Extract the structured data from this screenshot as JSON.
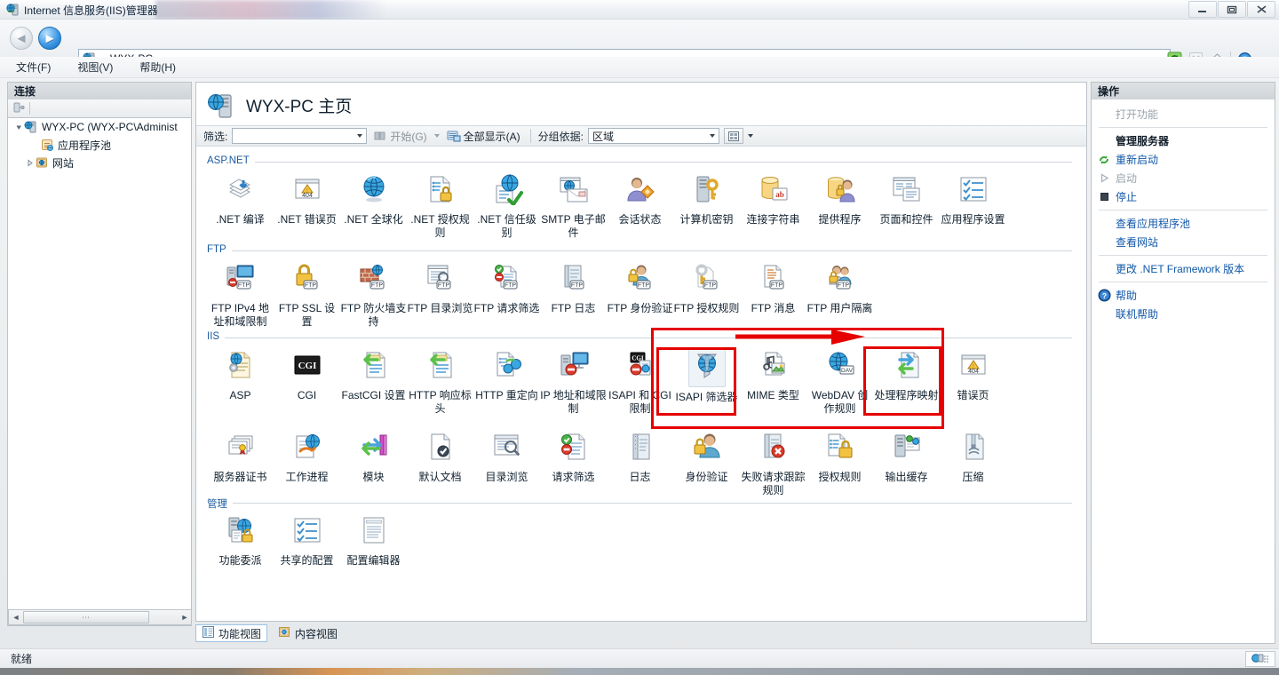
{
  "window": {
    "title": "Internet 信息服务(IIS)管理器",
    "title_icon": "iis-server-icon",
    "minimize_label": "最小化",
    "maximize_label": "最大化",
    "close_label": "关闭"
  },
  "navbar": {
    "back_label": "后退",
    "forward_label": "前进",
    "breadcrumb_icon": "server-icon",
    "breadcrumb": "WYX-PC",
    "sep": "▸",
    "tools": [
      {
        "name": "refresh-icon",
        "glyph": "↻",
        "color": "#2f9a2f"
      },
      {
        "name": "stop-icon",
        "glyph": "✕",
        "color": "#a8b2bb"
      },
      {
        "name": "home-icon",
        "glyph": "⌂",
        "color": "#8c949c"
      },
      {
        "name": "help-icon",
        "glyph": "?",
        "color": "#1d63b5"
      }
    ]
  },
  "menu": {
    "items": [
      {
        "label": "文件(F)",
        "name": "menu-file"
      },
      {
        "label": "视图(V)",
        "name": "menu-view"
      },
      {
        "label": "帮助(H)",
        "name": "menu-help"
      }
    ]
  },
  "connections": {
    "header": "连接",
    "toolbar_icon": "connect-icon",
    "tree": [
      {
        "label": "WYX-PC (WYX-PC\\Administ",
        "indent": 0,
        "twisty": "expanded",
        "icon": "server-icon"
      },
      {
        "label": "应用程序池",
        "indent": 1,
        "twisty": "none",
        "icon": "app-pool-icon"
      },
      {
        "label": "网站",
        "indent": 1,
        "twisty": "collapsed",
        "icon": "sites-icon"
      }
    ],
    "hscroll": {
      "left_arrow": "◄",
      "right_arrow": "►",
      "thumb": "⋯"
    }
  },
  "page": {
    "icon": "server-home-icon",
    "title": "WYX-PC 主页"
  },
  "filterbar": {
    "filter_label": "筛选:",
    "filter_value": "",
    "filter_placeholder": "",
    "go_label": "开始(G)",
    "showall_label": "全部显示(A)",
    "groupby_label": "分组依据:",
    "groupby_value": "区域",
    "view_button": "grid-view-icon"
  },
  "groups": [
    {
      "name": "ASP.NET",
      "title": "ASP.NET",
      "items": [
        {
          "label": ".NET 编译",
          "icon": "net-compilation-icon"
        },
        {
          "label": ".NET 错误页",
          "icon": "net-error-pages-icon"
        },
        {
          "label": ".NET 全球化",
          "icon": "net-globalization-icon"
        },
        {
          "label": ".NET 授权规则",
          "icon": "net-authorization-rules-icon"
        },
        {
          "label": ".NET 信任级别",
          "icon": "net-trust-levels-icon"
        },
        {
          "label": "SMTP 电子邮件",
          "icon": "smtp-email-icon"
        },
        {
          "label": "会话状态",
          "icon": "session-state-icon"
        },
        {
          "label": "计算机密钥",
          "icon": "machine-key-icon"
        },
        {
          "label": "连接字符串",
          "icon": "connection-strings-icon"
        },
        {
          "label": "提供程序",
          "icon": "providers-icon"
        },
        {
          "label": "页面和控件",
          "icon": "pages-and-controls-icon"
        },
        {
          "label": "应用程序设置",
          "icon": "application-settings-icon"
        }
      ]
    },
    {
      "name": "FTP",
      "title": "FTP",
      "items": [
        {
          "label": "FTP IPv4 地址和域限制",
          "icon": "ftp-ipv4-restrictions-icon"
        },
        {
          "label": "FTP SSL 设置",
          "icon": "ftp-ssl-settings-icon"
        },
        {
          "label": "FTP 防火墙支持",
          "icon": "ftp-firewall-support-icon"
        },
        {
          "label": "FTP 目录浏览",
          "icon": "ftp-directory-browsing-icon"
        },
        {
          "label": "FTP 请求筛选",
          "icon": "ftp-request-filtering-icon"
        },
        {
          "label": "FTP 日志",
          "icon": "ftp-logging-icon"
        },
        {
          "label": "FTP 身份验证",
          "icon": "ftp-authentication-icon"
        },
        {
          "label": "FTP 授权规则",
          "icon": "ftp-authorization-rules-icon"
        },
        {
          "label": "FTP 消息",
          "icon": "ftp-messages-icon"
        },
        {
          "label": "FTP 用户隔离",
          "icon": "ftp-user-isolation-icon"
        }
      ]
    },
    {
      "name": "IIS",
      "title": "IIS",
      "items": [
        {
          "label": "ASP",
          "icon": "asp-icon"
        },
        {
          "label": "CGI",
          "icon": "cgi-icon"
        },
        {
          "label": "FastCGI 设置",
          "icon": "fastcgi-settings-icon"
        },
        {
          "label": "HTTP 响应标头",
          "icon": "http-response-headers-icon"
        },
        {
          "label": "HTTP 重定向",
          "icon": "http-redirect-icon"
        },
        {
          "label": "IP 地址和域限制",
          "icon": "ip-address-restrictions-icon"
        },
        {
          "label": "ISAPI 和 CGI 限制",
          "icon": "isapi-cgi-restrictions-icon"
        },
        {
          "label": "ISAPI 筛选器",
          "icon": "isapi-filters-icon",
          "selected": true
        },
        {
          "label": "MIME 类型",
          "icon": "mime-types-icon"
        },
        {
          "label": "WebDAV 创作规则",
          "icon": "webdav-authoring-rules-icon"
        },
        {
          "label": "处理程序映射",
          "icon": "handler-mappings-icon"
        },
        {
          "label": "错误页",
          "icon": "error-pages-icon"
        },
        {
          "label": "服务器证书",
          "icon": "server-certificates-icon"
        },
        {
          "label": "工作进程",
          "icon": "worker-processes-icon"
        },
        {
          "label": "模块",
          "icon": "modules-icon"
        },
        {
          "label": "默认文档",
          "icon": "default-document-icon"
        },
        {
          "label": "目录浏览",
          "icon": "directory-browsing-icon"
        },
        {
          "label": "请求筛选",
          "icon": "request-filtering-icon"
        },
        {
          "label": "日志",
          "icon": "logging-icon"
        },
        {
          "label": "身份验证",
          "icon": "authentication-icon"
        },
        {
          "label": "失败请求跟踪规则",
          "icon": "failed-request-tracing-icon"
        },
        {
          "label": "授权规则",
          "icon": "authorization-rules-icon"
        },
        {
          "label": "输出缓存",
          "icon": "output-caching-icon"
        },
        {
          "label": "压缩",
          "icon": "compression-icon"
        }
      ]
    },
    {
      "name": "管理",
      "title": "管理",
      "items": [
        {
          "label": "功能委派",
          "icon": "feature-delegation-icon"
        },
        {
          "label": "共享的配置",
          "icon": "shared-configuration-icon"
        },
        {
          "label": "配置编辑器",
          "icon": "configuration-editor-icon"
        }
      ]
    }
  ],
  "actions": {
    "header": "操作",
    "items": [
      {
        "label": "打开功能",
        "state": "disabled",
        "icon": "none"
      },
      {
        "sep": true
      },
      {
        "label": "管理服务器",
        "state": "bold",
        "icon": "none"
      },
      {
        "label": "重新启动",
        "state": "link",
        "icon": "restart-icon"
      },
      {
        "label": "启动",
        "state": "disabled",
        "icon": "start-icon"
      },
      {
        "label": "停止",
        "state": "link",
        "icon": "stop-square-icon"
      },
      {
        "sep": true
      },
      {
        "label": "查看应用程序池",
        "state": "link",
        "icon": "none"
      },
      {
        "label": "查看网站",
        "state": "link",
        "icon": "none"
      },
      {
        "sep": true
      },
      {
        "label": "更改 .NET Framework 版本",
        "state": "link",
        "icon": "none"
      },
      {
        "sep": true
      },
      {
        "label": "帮助",
        "state": "link",
        "icon": "help-blue-icon"
      },
      {
        "label": "联机帮助",
        "state": "link",
        "icon": "none"
      }
    ]
  },
  "viewtabs": [
    {
      "label": "功能视图",
      "icon": "features-view-icon",
      "active": true
    },
    {
      "label": "内容视图",
      "icon": "content-view-icon",
      "active": false
    }
  ],
  "status": {
    "text": "就绪",
    "corner_icon": "resize-grip-icon"
  },
  "annotations": {
    "accent_color": "#e60000",
    "boxes": [
      {
        "name": "outer-highlight-box"
      },
      {
        "name": "isapi-filters-highlight-box"
      },
      {
        "name": "handler-mappings-highlight-box"
      }
    ],
    "arrow": {
      "name": "pointer-arrow",
      "direction": "right"
    }
  }
}
